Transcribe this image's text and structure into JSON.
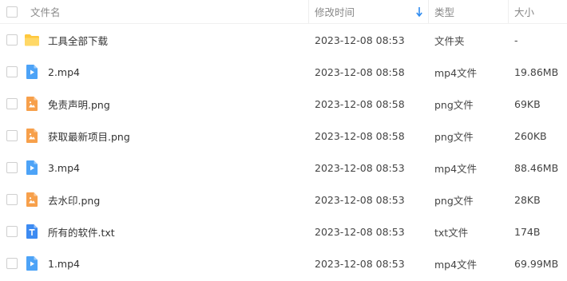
{
  "header": {
    "name": "文件名",
    "modified": "修改时间",
    "type": "类型",
    "size": "大小"
  },
  "files": [
    {
      "name": "工具全部下载",
      "modified": "2023-12-08 08:53",
      "type": "文件夹",
      "size": "-",
      "icon": "folder-icon"
    },
    {
      "name": "2.mp4",
      "modified": "2023-12-08 08:58",
      "type": "mp4文件",
      "size": "19.86MB",
      "icon": "video-file-icon"
    },
    {
      "name": "免责声明.png",
      "modified": "2023-12-08 08:58",
      "type": "png文件",
      "size": "69KB",
      "icon": "image-file-icon"
    },
    {
      "name": "获取最新项目.png",
      "modified": "2023-12-08 08:58",
      "type": "png文件",
      "size": "260KB",
      "icon": "image-file-icon"
    },
    {
      "name": "3.mp4",
      "modified": "2023-12-08 08:53",
      "type": "mp4文件",
      "size": "88.46MB",
      "icon": "video-file-icon"
    },
    {
      "name": "去水印.png",
      "modified": "2023-12-08 08:53",
      "type": "png文件",
      "size": "28KB",
      "icon": "image-file-icon"
    },
    {
      "name": "所有的软件.txt",
      "modified": "2023-12-08 08:53",
      "type": "txt文件",
      "size": "174B",
      "icon": "text-file-icon"
    },
    {
      "name": "1.mp4",
      "modified": "2023-12-08 08:53",
      "type": "mp4文件",
      "size": "69.99MB",
      "icon": "video-file-icon"
    }
  ],
  "colors": {
    "folder": "#FFC83D",
    "video": "#4DA3F7",
    "image": "#F7A04B",
    "text": "#3D8BF2",
    "sort_arrow": "#2E8BF0"
  }
}
